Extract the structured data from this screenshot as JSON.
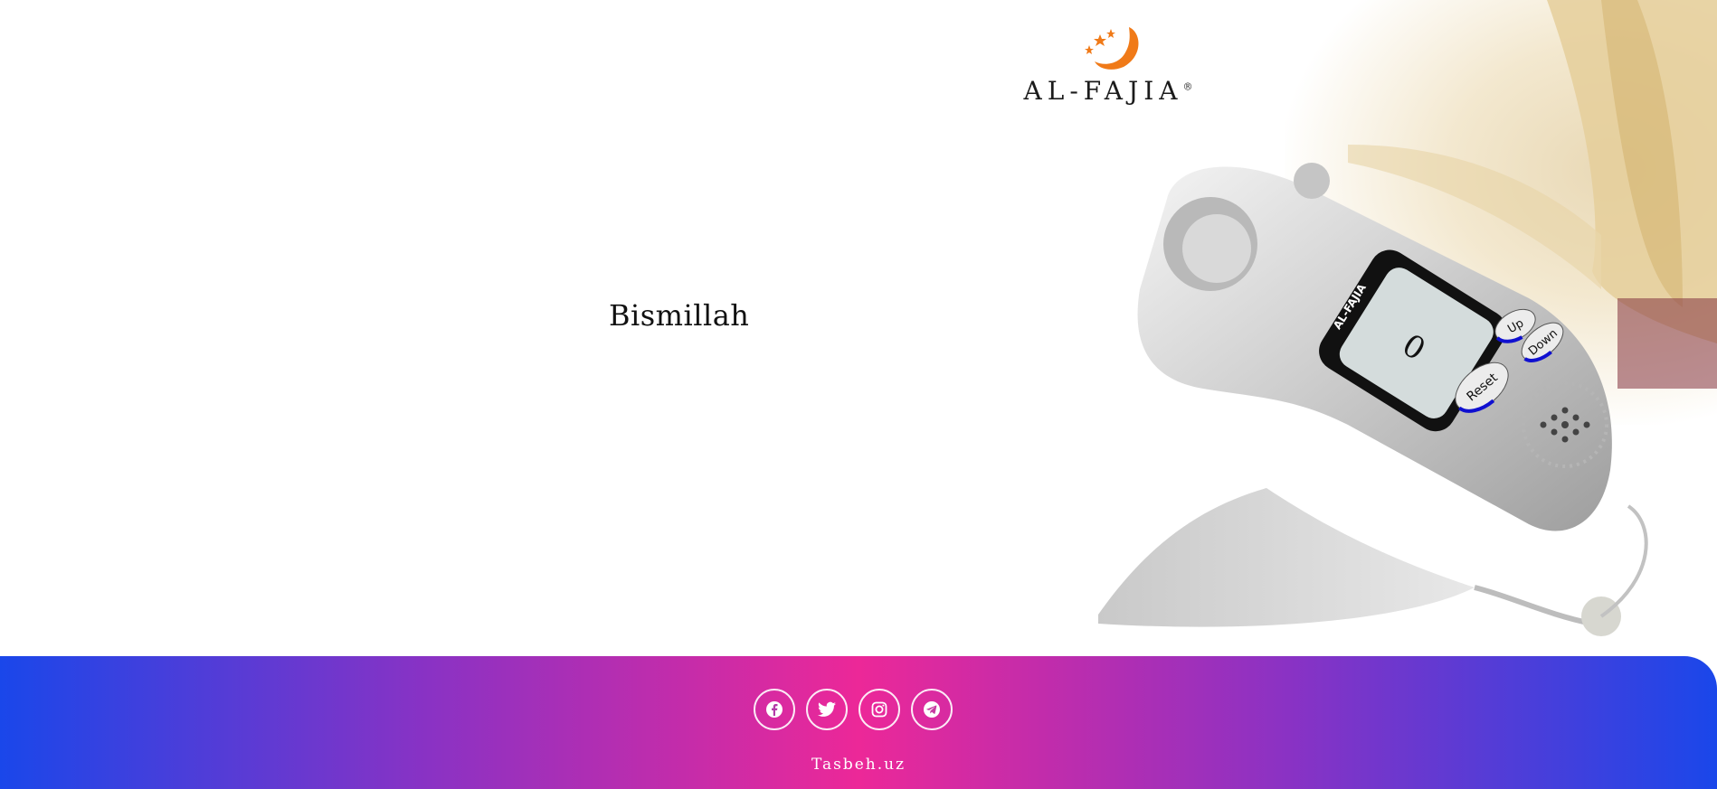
{
  "main": {
    "title": "Bismillah"
  },
  "logo": {
    "brand_name": "AL-FAJIA",
    "registered_mark": "®"
  },
  "device": {
    "counter_value": "0",
    "brand_label": "AL-FAJIA",
    "buttons": {
      "up": "Up",
      "down": "Down",
      "reset": "Reset"
    }
  },
  "footer": {
    "social": [
      {
        "icon": "facebook-icon"
      },
      {
        "icon": "twitter-icon"
      },
      {
        "icon": "instagram-icon"
      },
      {
        "icon": "telegram-icon"
      }
    ],
    "site_name": "Tasbeh.uz"
  },
  "colors": {
    "footer_gradient": [
      "#1a47ea",
      "#8a32c4",
      "#ec2898"
    ],
    "accent_blue": "#1010d0",
    "logo_orange": "#f07a18"
  }
}
